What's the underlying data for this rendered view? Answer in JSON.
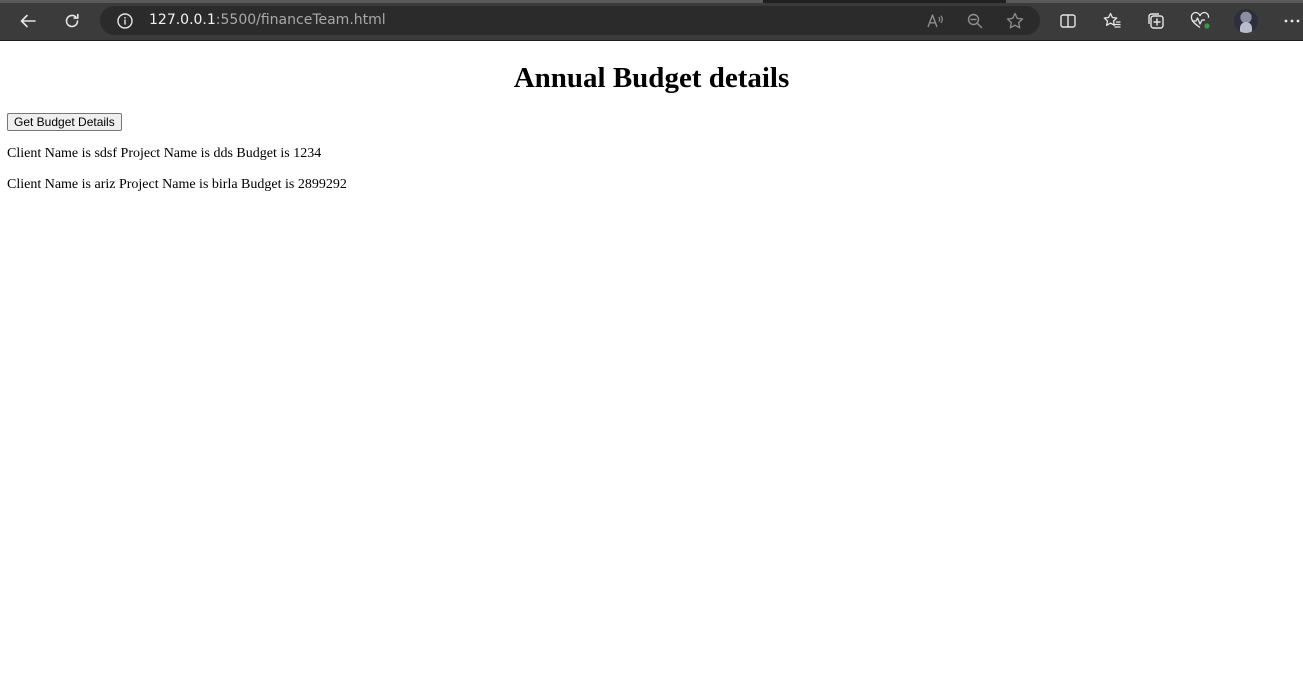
{
  "browser": {
    "url_host": "127.0.0.1",
    "url_rest": ":5500/financeTeam.html",
    "icons": {
      "back": "back-arrow-icon",
      "reload": "reload-icon",
      "site_info": "info-icon",
      "read_aloud": "read-aloud-icon",
      "zoom": "zoom-out-icon",
      "favorite": "star-icon",
      "split_screen": "split-screen-icon",
      "favorites": "favorites-icon",
      "collections": "collections-icon",
      "performance": "heartbeat-icon",
      "profile": "avatar",
      "menu": "more-icon"
    },
    "colors": {
      "toolbar": "#3b3b3b",
      "omnibox": "#2b2b2b",
      "icon": "#e6e6e6",
      "status_dot": "#2ea043"
    }
  },
  "page": {
    "title": "Annual Budget details",
    "button_label": "Get Budget Details",
    "records": [
      "Client Name is sdsf Project Name is dds Budget is 1234",
      "Client Name is ariz Project Name is birla Budget is 2899292"
    ]
  }
}
